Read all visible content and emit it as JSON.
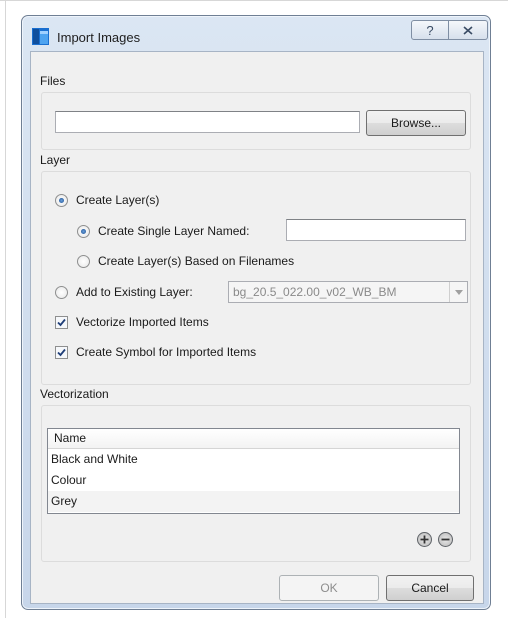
{
  "window": {
    "title": "Import Images",
    "help_glyph": "?",
    "accent": "#1a6fd0"
  },
  "files": {
    "group_label": "Files",
    "path_value": "",
    "browse_label": "Browse..."
  },
  "layer": {
    "group_label": "Layer",
    "create_layers_label": "Create Layer(s)",
    "create_single_label": "Create Single Layer Named:",
    "single_name_value": "",
    "based_on_filenames_label": "Create Layer(s) Based on Filenames",
    "add_existing_label": "Add to Existing Layer:",
    "existing_layer_value": "bg_20.5_022.00_v02_WB_BM",
    "vectorize_label": "Vectorize Imported Items",
    "create_symbol_label": "Create Symbol for Imported Items",
    "selected_option": "Create Layer(s)",
    "selected_sub_option": "Create Single Layer Named:",
    "vectorize_checked": true,
    "create_symbol_checked": true
  },
  "vectorization": {
    "group_label": "Vectorization",
    "column_header": "Name",
    "items": [
      "Black and White",
      "Colour",
      "Grey"
    ],
    "add_icon": "plus-circle-icon",
    "remove_icon": "minus-circle-icon"
  },
  "footer": {
    "ok_label": "OK",
    "cancel_label": "Cancel"
  }
}
